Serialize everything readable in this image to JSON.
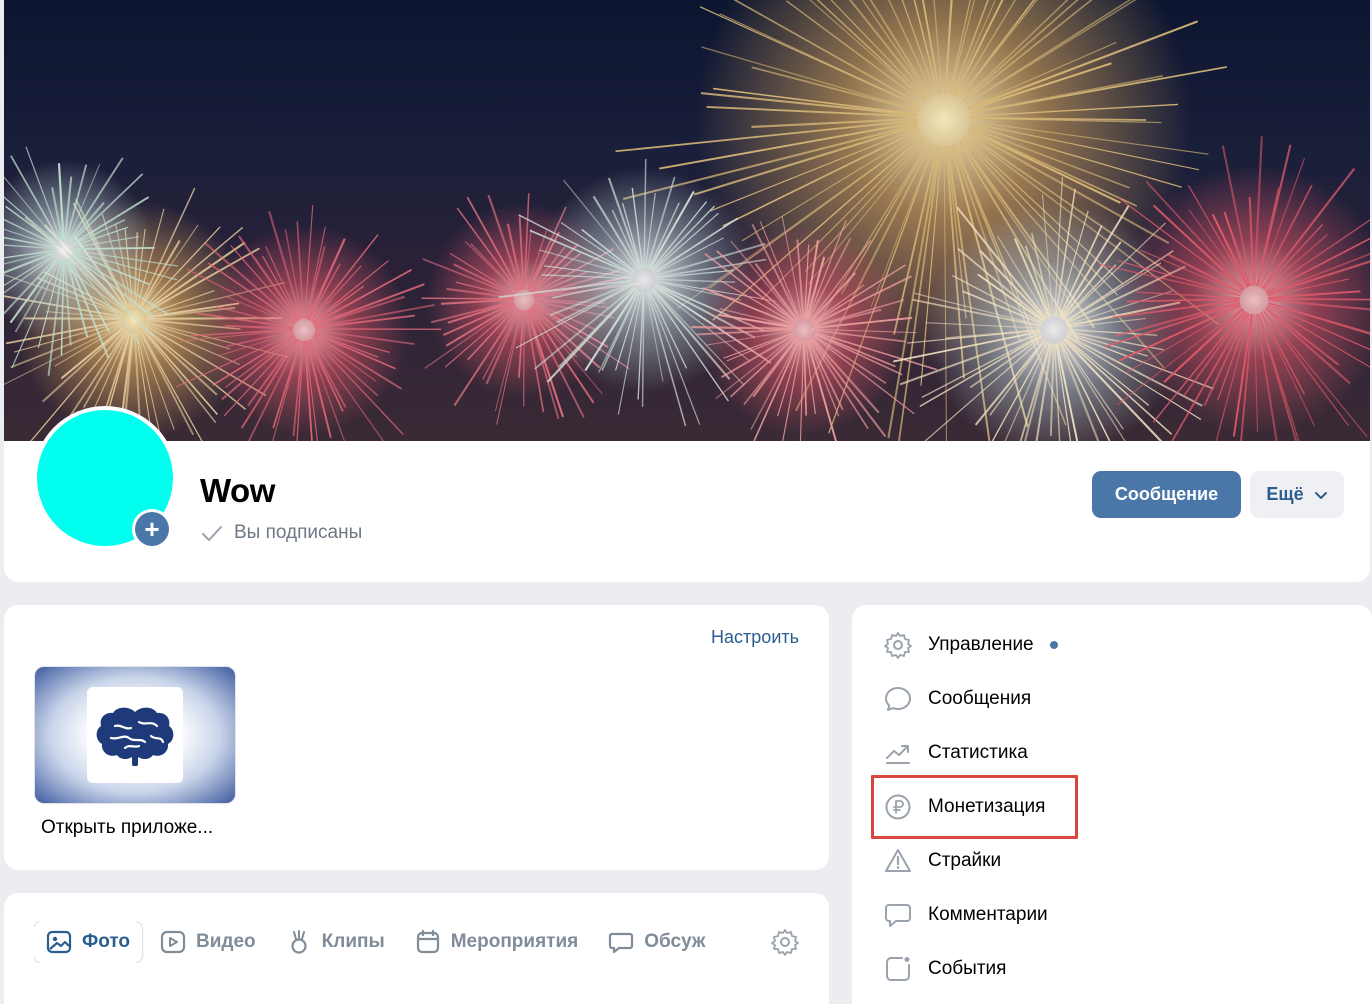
{
  "group": {
    "name": "Wow",
    "subscribed_label": "Вы подписаны",
    "message_button": "Сообщение",
    "more_button": "Ещё"
  },
  "app_widget": {
    "configure_label": "Настроить",
    "app_caption": "Открыть приложе..."
  },
  "tabs": {
    "photo": "Фото",
    "video": "Видео",
    "clips": "Клипы",
    "events": "Мероприятия",
    "discussions": "Обсуж"
  },
  "menu": {
    "items": [
      {
        "label": "Управление",
        "icon": "gear-icon",
        "has_dot": true
      },
      {
        "label": "Сообщения",
        "icon": "chat-bubble-icon"
      },
      {
        "label": "Статистика",
        "icon": "stats-trend-icon"
      },
      {
        "label": "Монетизация",
        "icon": "ruble-coin-icon",
        "highlighted": true
      },
      {
        "label": "Страйки",
        "icon": "warning-icon"
      },
      {
        "label": "Комментарии",
        "icon": "comment-icon"
      },
      {
        "label": "События",
        "icon": "events-icon"
      }
    ]
  },
  "colors": {
    "accent": "#4a76a8",
    "link": "#2c5d8f",
    "avatar": "#00ffee",
    "highlight_border": "#d9463d",
    "muted_text": "#818c99"
  }
}
